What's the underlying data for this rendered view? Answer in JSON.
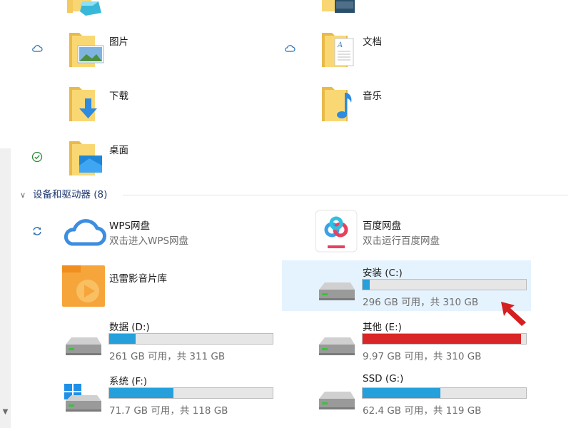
{
  "folders": [
    {
      "name": "图片",
      "sync": "cloud"
    },
    {
      "name": "文档",
      "sync": "cloud"
    },
    {
      "name": "下载",
      "sync": ""
    },
    {
      "name": "音乐",
      "sync": ""
    },
    {
      "name": "桌面",
      "sync": "check"
    }
  ],
  "group": {
    "label": "设备和驱动器 (8)"
  },
  "apps": [
    {
      "name": "WPS网盘",
      "desc": "双击进入WPS网盘"
    },
    {
      "name": "百度网盘",
      "desc": "双击运行百度网盘"
    },
    {
      "name": "迅雷影音片库"
    }
  ],
  "drives": [
    {
      "name": "安装 (C:)",
      "status": "296 GB 可用，共 310 GB",
      "used_fraction": 0.045,
      "color": "#26a0da",
      "selected": true
    },
    {
      "name": "数据 (D:)",
      "status": "261 GB 可用，共 311 GB",
      "used_fraction": 0.16,
      "color": "#26a0da"
    },
    {
      "name": "其他 (E:)",
      "status": "9.97 GB 可用，共 310 GB",
      "used_fraction": 0.968,
      "color": "#da2626"
    },
    {
      "name": "系统 (F:)",
      "status": "71.7 GB 可用，共 118 GB",
      "used_fraction": 0.393,
      "color": "#26a0da"
    },
    {
      "name": "SSD (G:)",
      "status": "62.4 GB 可用，共 119 GB",
      "used_fraction": 0.476,
      "color": "#26a0da"
    }
  ],
  "colors": {
    "selection": "#e5f3ff",
    "bar_blue": "#26a0da",
    "bar_red": "#da2626",
    "annotation_arrow": "#d61f1f"
  }
}
